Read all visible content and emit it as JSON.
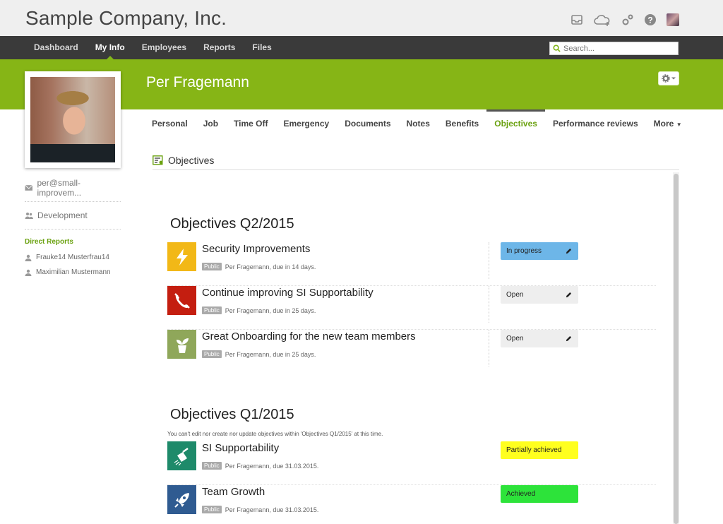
{
  "header": {
    "company": "Sample Company, Inc."
  },
  "nav": {
    "items": [
      {
        "label": "Dashboard",
        "active": false
      },
      {
        "label": "My Info",
        "active": true
      },
      {
        "label": "Employees",
        "active": false
      },
      {
        "label": "Reports",
        "active": false
      },
      {
        "label": "Files",
        "active": false
      }
    ],
    "search_placeholder": "Search..."
  },
  "profile": {
    "name": "Per Fragemann",
    "email": "per@small-improvem...",
    "department": "Development",
    "direct_reports_label": "Direct Reports",
    "direct_reports": [
      "Frauke14 Musterfrau14",
      "Maximilian Mustermann"
    ]
  },
  "tabs": [
    {
      "label": "Personal",
      "active": false
    },
    {
      "label": "Job",
      "active": false
    },
    {
      "label": "Time Off",
      "active": false
    },
    {
      "label": "Emergency",
      "active": false
    },
    {
      "label": "Documents",
      "active": false
    },
    {
      "label": "Notes",
      "active": false
    },
    {
      "label": "Benefits",
      "active": false
    },
    {
      "label": "Objectives",
      "active": true
    },
    {
      "label": "Performance reviews",
      "active": false
    },
    {
      "label": "More",
      "active": false
    }
  ],
  "section": {
    "title": "Objectives"
  },
  "groups": [
    {
      "title": "Objectives Q2/2015",
      "note": "",
      "objectives": [
        {
          "title": "Security Improvements",
          "badge": "Public",
          "meta": "Per Fragemann, due in 14 days.",
          "status": "In progress",
          "tile_color": "#f2b817",
          "icon": "lightning-icon",
          "editable": true
        },
        {
          "title": "Continue improving SI Supportability",
          "badge": "Public",
          "meta": "Per Fragemann, due in 25 days.",
          "status": "Open",
          "tile_color": "#c41e10",
          "icon": "phone-icon",
          "editable": true
        },
        {
          "title": "Great Onboarding for the new team members",
          "badge": "Public",
          "meta": "Per Fragemann, due in 25 days.",
          "status": "Open",
          "tile_color": "#8fa75a",
          "icon": "plant-icon",
          "editable": true
        }
      ]
    },
    {
      "title": "Objectives Q1/2015",
      "note": "You can't edit nor create nor update objectives within 'Objectives Q1/2015' at this time.",
      "objectives": [
        {
          "title": "SI Supportability",
          "badge": "Public",
          "meta": "Per Fragemann, due 31.03.2015.",
          "status": "Partially achieved",
          "tile_color": "#1e8a6a",
          "icon": "watering-can-icon",
          "editable": false
        },
        {
          "title": "Team Growth",
          "badge": "Public",
          "meta": "Per Fragemann, due 31.03.2015.",
          "status": "Achieved",
          "tile_color": "#2f5b91",
          "icon": "rocket-icon",
          "editable": false
        }
      ]
    }
  ],
  "colors": {
    "brand_green": "#86b516",
    "nav_dark": "#3a3a3a",
    "in_progress": "#6db6e8",
    "partially_achieved": "#ffff1f",
    "achieved": "#2de33a"
  }
}
